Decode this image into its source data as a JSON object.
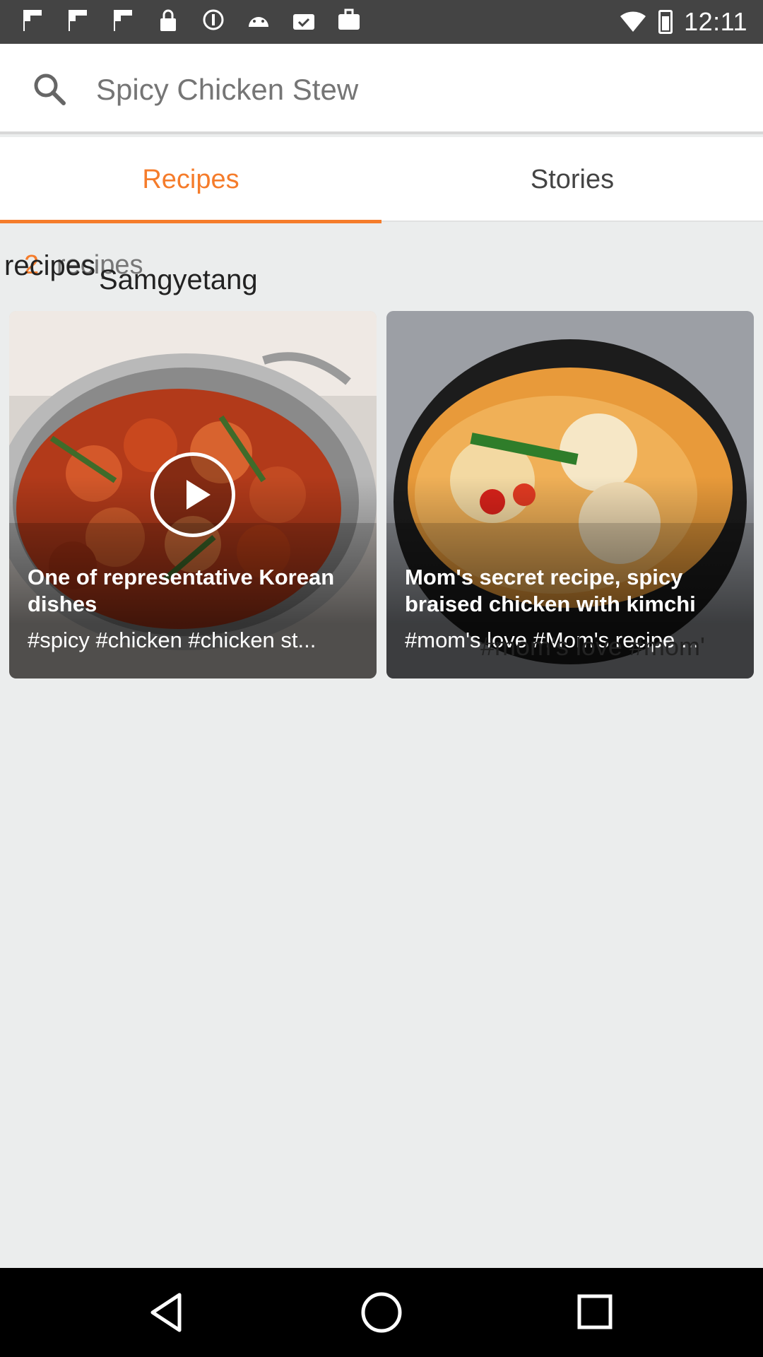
{
  "status_bar": {
    "time": "12:11",
    "icons": [
      "flipboard-icon",
      "flipboard-icon",
      "flipboard-icon",
      "lock-icon",
      "info-icon",
      "android-icon",
      "check-bag-icon",
      "bag-icon"
    ]
  },
  "search": {
    "value": "Spicy Chicken Stew",
    "placeholder": "Spicy Chicken Stew"
  },
  "tabs": [
    {
      "label": "Recipes",
      "active": true
    },
    {
      "label": "Stories",
      "active": false
    }
  ],
  "results": {
    "count": "2",
    "count_label": "recipes",
    "overlay_label": "recipes",
    "overlay_keyword": "Samgyetang"
  },
  "cards": [
    {
      "title": "One of representative Korean dishes",
      "tags": "#spicy #chicken #chicken st...",
      "has_video": true
    },
    {
      "title": "Mom's secret recipe, spicy braised chicken with kimchi",
      "tags": "#mom's love #Mom's recipe ...",
      "has_video": false,
      "overlay_tags": "#mom's love #mom'"
    }
  ],
  "colors": {
    "accent": "#f57c2b",
    "background": "#ebeded",
    "status_bar": "#444444",
    "nav_bar": "#000000"
  }
}
